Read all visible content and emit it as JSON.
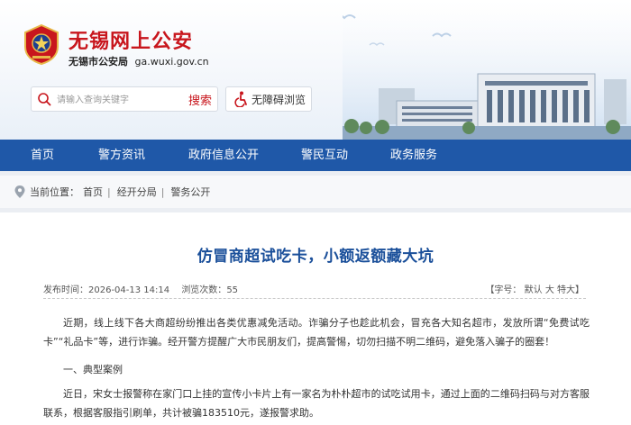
{
  "header": {
    "site_title": "无锡网上公安",
    "org": "无锡市公安局",
    "domain": "ga.wuxi.gov.cn",
    "search_placeholder": "请输入查询关键字",
    "search_button": "搜索",
    "accessibility_label": "无障碍浏览"
  },
  "nav": {
    "items": [
      "首页",
      "警方资讯",
      "政府信息公开",
      "警民互动",
      "政务服务"
    ]
  },
  "breadcrumb": {
    "prefix": "当前位置：",
    "items": [
      "首页",
      "经开分局",
      "警务公开"
    ]
  },
  "article": {
    "title": "仿冒商超试吃卡，小额返额藏大坑",
    "publish_label": "发布时间：",
    "publish_time": "2026-04-13 14:14",
    "views_label": "浏览次数：",
    "views": "55",
    "font_size_label": "【字号：",
    "font_default": "默认",
    "font_large": "大",
    "font_xlarge": "特大",
    "font_size_close": "】",
    "paragraphs": [
      "近期，线上线下各大商超纷纷推出各类优惠减免活动。诈骗分子也趁此机会，冒充各大知名超市，发放所谓“免费试吃卡”“礼品卡”等，进行诈骗。经开警方提醒广大市民朋友们，提高警惕，切勿扫描不明二维码，避免落入骗子的圈套！",
      "一、典型案例",
      "近日，宋女士报警称在家门口上挂的宣传小卡片上有一家名为朴朴超市的试吃试用卡，通过上面的二维码扫码与对方客服联系，根据客服指引刷单，共计被骗183510元，遂报警求助。"
    ]
  },
  "colors": {
    "brand_red": "#c8161d",
    "nav_blue": "#1f58a8",
    "title_blue": "#1a4f9a"
  }
}
